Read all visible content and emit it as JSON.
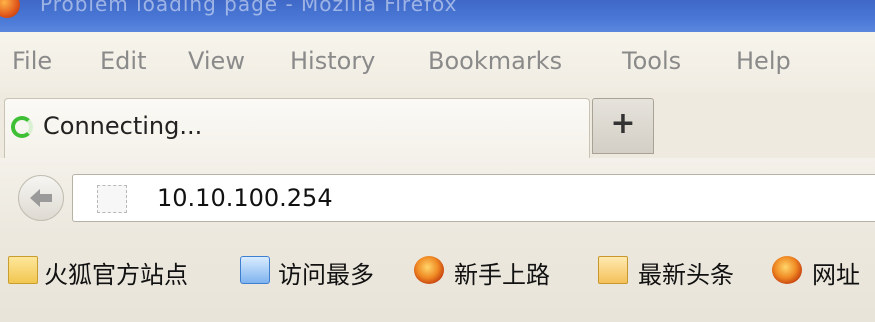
{
  "window": {
    "title": "Problem loading page - Mozilla Firefox"
  },
  "menu": [
    {
      "label": "File"
    },
    {
      "label": "Edit"
    },
    {
      "label": "View"
    },
    {
      "label": "History"
    },
    {
      "label": "Bookmarks"
    },
    {
      "label": "Tools"
    },
    {
      "label": "Help"
    }
  ],
  "tab": {
    "label": "Connecting...",
    "status_icon": "loading-spinner-icon"
  },
  "new_tab": {
    "label": "+"
  },
  "navigation": {
    "url": "10.10.100.254",
    "back_icon": "back-arrow-icon",
    "identity_icon": "site-identity-icon"
  },
  "bookmarks": [
    {
      "label": "火狐官方站点",
      "icon": "folder-icon"
    },
    {
      "label": "访问最多",
      "icon": "search-folder-icon"
    },
    {
      "label": "新手上路",
      "icon": "firefox-icon"
    },
    {
      "label": "最新头条",
      "icon": "rss-feed-icon"
    },
    {
      "label": "网址",
      "icon": "firefox-icon"
    }
  ],
  "colors": {
    "titlebar": "#4a78d6",
    "chrome": "#f1ede3",
    "spinner": "#3fbf36"
  }
}
